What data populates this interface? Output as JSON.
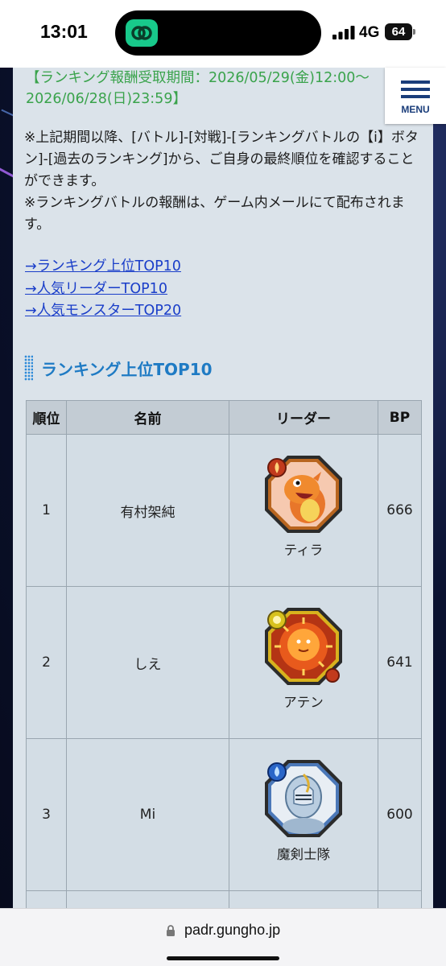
{
  "status": {
    "time": "13:01",
    "network": "4G",
    "battery": "64"
  },
  "menu": {
    "label": "MENU"
  },
  "period_text": "【ランキング報酬受取期間：2026/05/29(金)12:00～2026/06/28(日)23:59】",
  "notes": [
    "※上記期間以降、[バトル]-[対戦]-[ランキングバトルの【i】ボタン]-[過去のランキング]から、ご自身の最終順位を確認することができます。",
    "※ランキングバトルの報酬は、ゲーム内メールにて配布されます。"
  ],
  "links": [
    "→ランキング上位TOP10",
    "→人気リーダーTOP10",
    "→人気モンスターTOP20"
  ],
  "section_title": "ランキング上位TOP10",
  "table": {
    "headers": [
      "順位",
      "名前",
      "リーダー",
      "BP"
    ],
    "rows": [
      {
        "rank": "1",
        "name": "有村架純",
        "leader": "ティラ",
        "bp": "666"
      },
      {
        "rank": "2",
        "name": "しえ",
        "leader": "アテン",
        "bp": "641"
      },
      {
        "rank": "3",
        "name": "Mi",
        "leader": "魔剣士隊",
        "bp": "600"
      }
    ]
  },
  "url": "padr.gungho.jp",
  "colors": {
    "period_green": "#3aa34c",
    "link_blue": "#1a3ec9",
    "section_blue": "#1f7bc4",
    "menu_navy": "#1a3d7a"
  }
}
